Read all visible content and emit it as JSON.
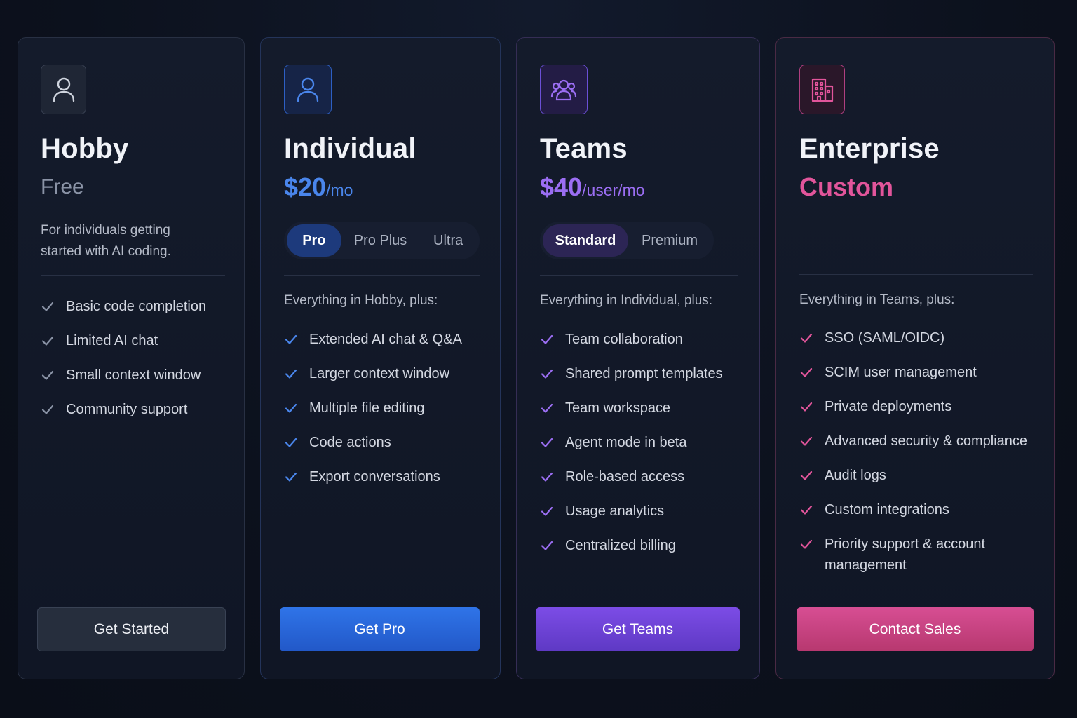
{
  "colors": {
    "hobby": "#8a93a6",
    "individual": "#4a86ec",
    "teams": "#9b6ef3",
    "enterprise": "#e2559b"
  },
  "plans": [
    {
      "icon": "user-icon",
      "name": "Hobby",
      "price": "Free",
      "unit": "",
      "description": "For individuals getting started with AI coding.",
      "features": [
        "Basic code completion",
        "Limited AI chat",
        "Small context window",
        "Community support"
      ],
      "cta": "Get Started"
    },
    {
      "icon": "user-icon",
      "name": "Individual",
      "price": "$20",
      "unit": "/mo",
      "options": [
        "Pro",
        "Pro Plus",
        "Ultra"
      ],
      "selected_option": "Pro",
      "intro": "Everything in Hobby, plus:",
      "features": [
        "Extended AI chat & Q&A",
        "Larger context window",
        "Multiple file editing",
        "Code actions",
        "Export conversations"
      ],
      "cta": "Get Pro"
    },
    {
      "icon": "users-icon",
      "name": "Teams",
      "price": "$40",
      "unit": "/user/mo",
      "options": [
        "Standard",
        "Premium"
      ],
      "selected_option": "Standard",
      "intro": "Everything in Individual, plus:",
      "features": [
        "Team collaboration",
        "Shared prompt templates",
        "Team workspace",
        "Agent mode in beta",
        "Role-based access",
        "Usage analytics",
        "Centralized billing"
      ],
      "cta": "Get Teams"
    },
    {
      "icon": "building-icon",
      "name": "Enterprise",
      "price": "Custom",
      "unit": "",
      "intro": "Everything in Teams, plus:",
      "features": [
        "SSO (SAML/OIDC)",
        "SCIM user management",
        "Private deployments",
        "Advanced security & compliance",
        "Audit logs",
        "Custom integrations",
        "Priority support & account management"
      ],
      "cta": "Contact Sales"
    }
  ]
}
